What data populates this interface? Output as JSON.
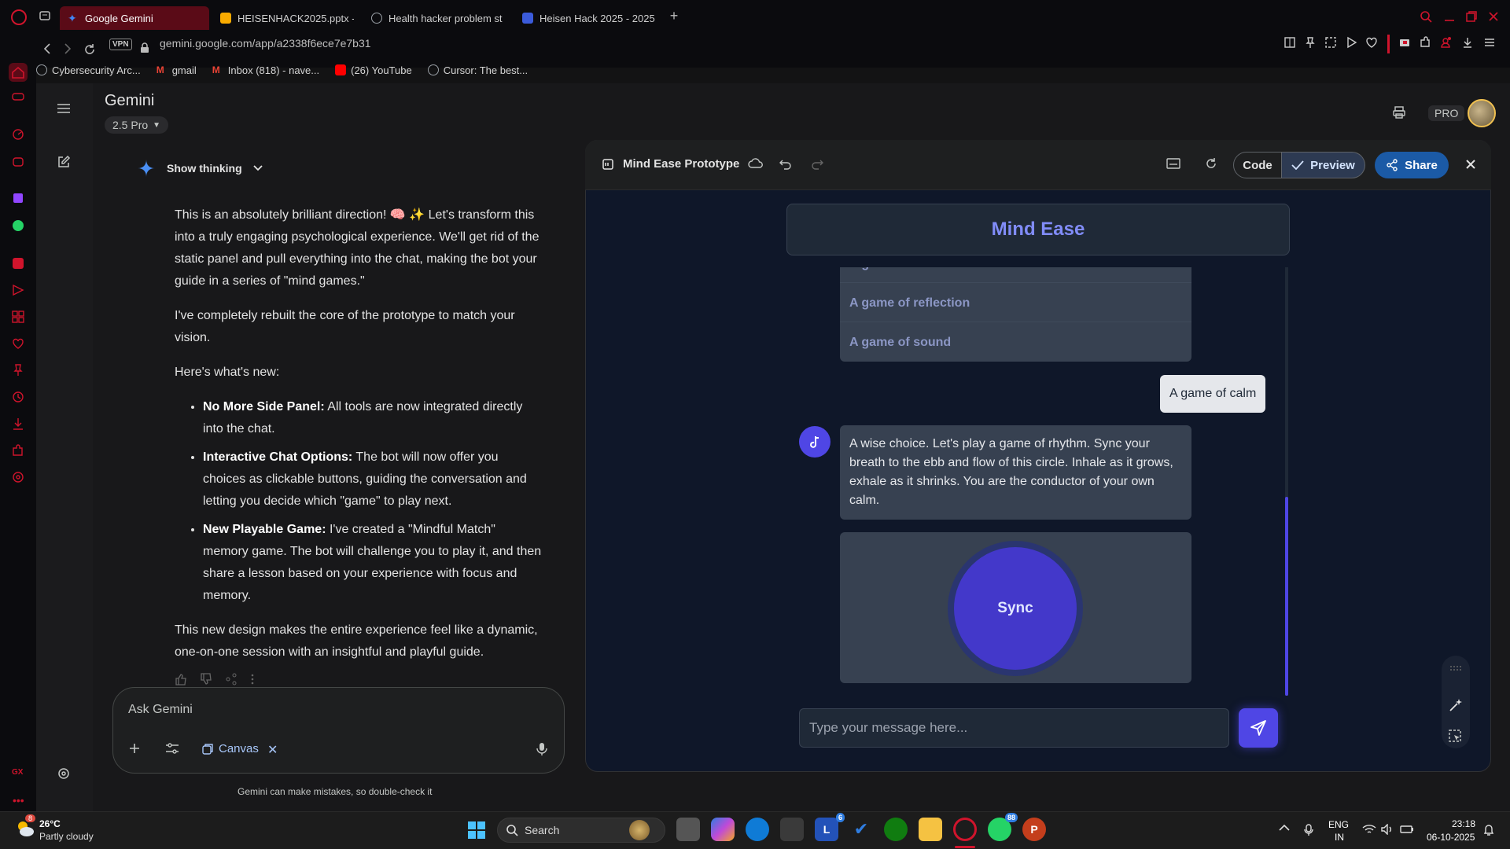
{
  "browser": {
    "tabs": [
      {
        "label": "Google Gemini",
        "active": true,
        "color": "#4285f4"
      },
      {
        "label": "HEISENHACK2025.pptx -",
        "active": false,
        "color": "#f9ab00"
      },
      {
        "label": "Health hacker problem st",
        "active": false,
        "color": "#9aa0a6"
      },
      {
        "label": "Heisen Hack 2025 - 2025",
        "active": false,
        "color": "#3b5bdb"
      }
    ],
    "vpn": "VPN",
    "url": "gemini.google.com/app/a2338f6ece7e7b31",
    "bookmarks": [
      {
        "label": "Cybersecurity Arc...",
        "color": "#9aa0a6"
      },
      {
        "label": "gmail",
        "color": "#ea4335"
      },
      {
        "label": "Inbox (818) - nave...",
        "color": "#ea4335"
      },
      {
        "label": "(26) YouTube",
        "color": "#ff0000"
      },
      {
        "label": "Cursor: The best...",
        "color": "#9aa0a6"
      }
    ]
  },
  "gemini": {
    "title": "Gemini",
    "model": "2.5 Pro",
    "show_thinking": "Show thinking",
    "response": {
      "p1": "This is an absolutely brilliant direction! 🧠 ✨ Let's transform this into a truly engaging psychological experience. We'll get rid of the static panel and pull everything into the chat, making the bot your guide in a series of \"mind games.\"",
      "p2": "I've completely rebuilt the core of the prototype to match your vision.",
      "p3": "Here's what's new:",
      "bullets": [
        {
          "bold": "No More Side Panel:",
          "text": " All tools are now integrated directly into the chat."
        },
        {
          "bold": "Interactive Chat Options:",
          "text": " The bot will now offer you choices as clickable buttons, guiding the conversation and letting you decide which \"game\" to play next."
        },
        {
          "bold": "New Playable Game:",
          "text": " I've created a \"Mindful Match\" memory game. The bot will challenge you to play it, and then share a lesson based on your experience with focus and memory."
        }
      ],
      "p4": "This new design makes the entire experience feel like a dynamic, one-on-one session with an insightful and playful guide."
    },
    "ask_placeholder": "Ask Gemini",
    "canvas_chip": "Canvas",
    "disclaimer": "Gemini can make mistakes, so double-check it",
    "pro_badge": "PRO"
  },
  "canvas": {
    "title": "Mind Ease Prototype",
    "code_label": "Code",
    "preview_label": "Preview",
    "share_label": "Share",
    "app": {
      "title": "Mind Ease",
      "options": [
        "A game of calm",
        "A game of reflection",
        "A game of sound"
      ],
      "user_message": "A game of calm",
      "bot_message": "A wise choice. Let's play a game of rhythm. Sync your breath to the ebb and flow of this circle. Inhale as it grows, exhale as it shrinks. You are the conductor of your own calm.",
      "sync_label": "Sync",
      "input_placeholder": "Type your message here..."
    }
  },
  "taskbar": {
    "weather_temp": "26°C",
    "weather_desc": "Partly cloudy",
    "weather_badge": "8",
    "search_label": "Search",
    "teams_badge": "6",
    "whatsapp_badge": "88",
    "lang_top": "ENG",
    "lang_bot": "IN",
    "time": "23:18",
    "date": "06-10-2025"
  },
  "colors": {
    "accent_red": "#d0142c",
    "canvas_indigo": "#4f46e5",
    "title_indigo": "#818cf8",
    "share_blue": "#1b5aa6"
  }
}
